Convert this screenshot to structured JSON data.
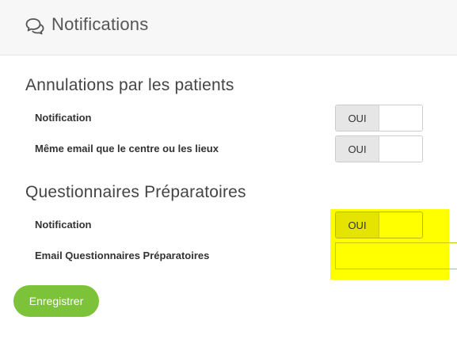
{
  "header": {
    "title": "Notifications",
    "icon": "chat-bubbles-icon"
  },
  "sections": [
    {
      "title": "Annulations par les patients",
      "fields": [
        {
          "label": "Notification",
          "type": "toggle",
          "value": "OUI"
        },
        {
          "label": "Même email que le centre ou les lieux",
          "type": "toggle",
          "value": "OUI"
        }
      ]
    },
    {
      "title": "Questionnaires Préparatoires",
      "fields": [
        {
          "label": "Notification",
          "type": "toggle",
          "value": "OUI"
        },
        {
          "label": "Email Questionnaires Préparatoires",
          "type": "text",
          "value": ""
        }
      ]
    }
  ],
  "actions": {
    "save_label": "Enregistrer"
  },
  "colors": {
    "accent": "#7dc33a",
    "highlight": "#ffff00",
    "header_bg": "#f7f7f7"
  }
}
